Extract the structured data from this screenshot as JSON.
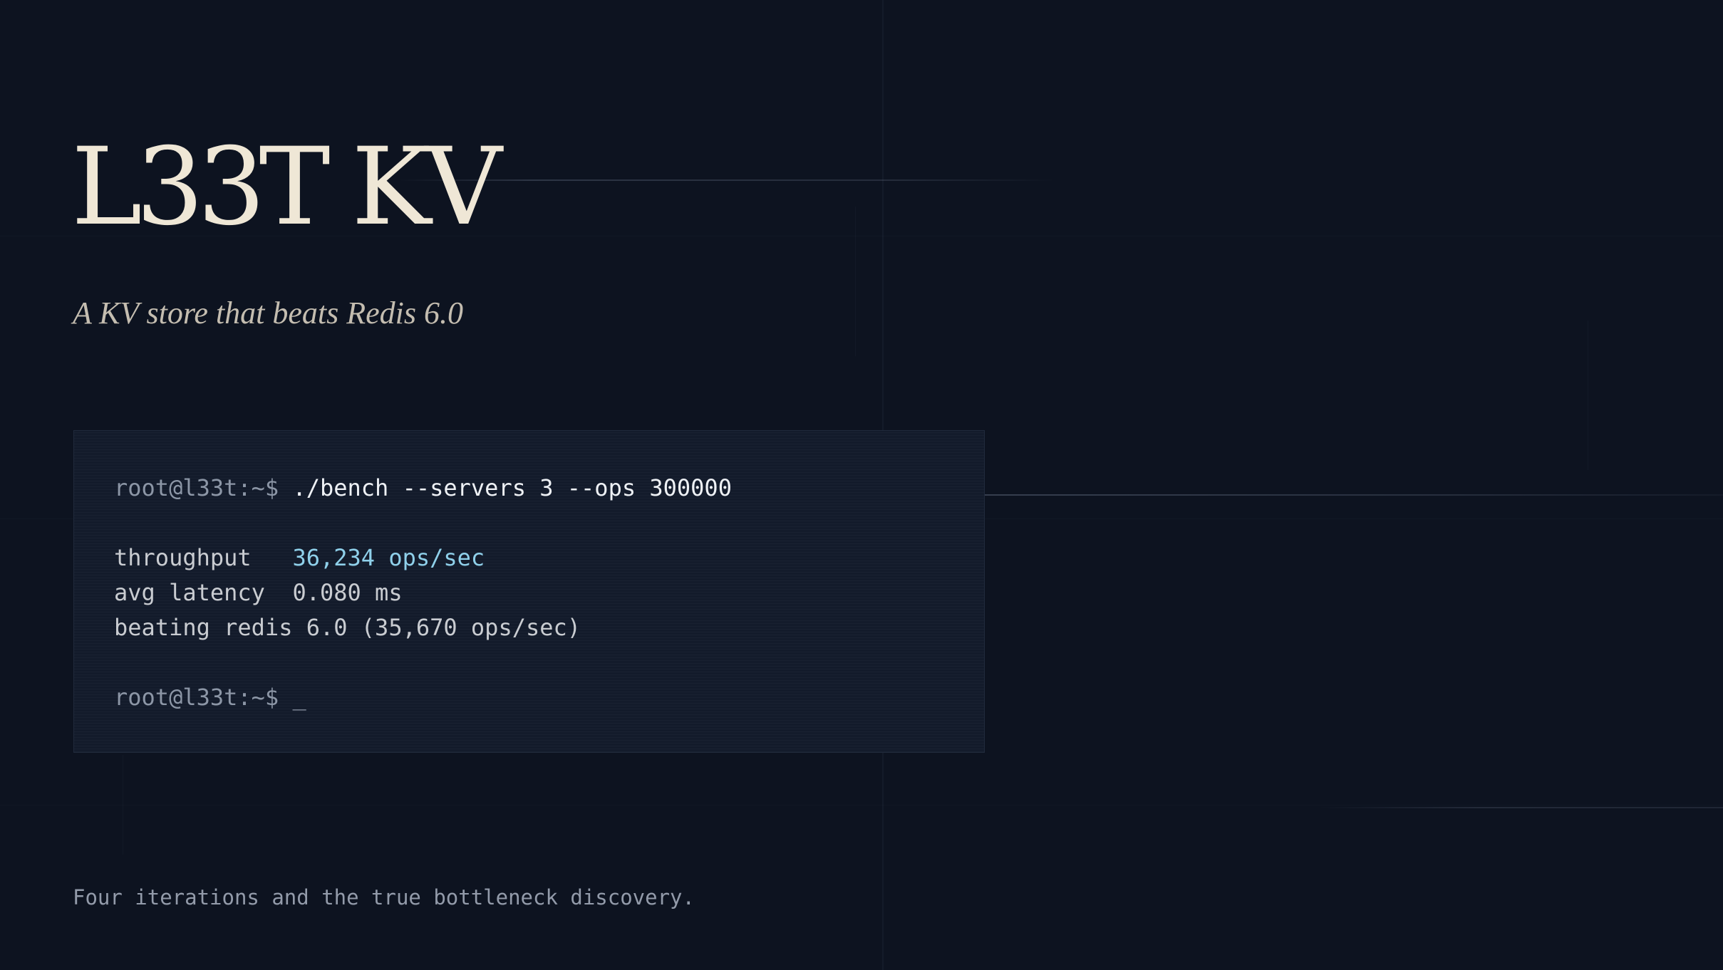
{
  "slide": {
    "title": "L33T KV",
    "subtitle": "A KV store that beats Redis 6.0",
    "caption": "Four iterations and the true bottleneck discovery."
  },
  "terminal": {
    "prompt": "root@l33t:~$",
    "command": "./bench --servers 3 --ops 300000",
    "throughput_label": "throughput",
    "throughput_value": "36,234 ops/sec",
    "latency_label": "avg latency",
    "latency_value": "0.080 ms",
    "comparison": "beating redis 6.0 (35,670 ops/sec)",
    "cursor": "_"
  },
  "colors": {
    "background": "#0d1320",
    "title": "#efe7d6",
    "subtitle": "#c4bdb0",
    "terminal_bg": "#131b2b",
    "prompt": "#8c96a6",
    "command": "#eef1f5",
    "highlight": "#8fd0ea",
    "caption": "#939baa"
  }
}
